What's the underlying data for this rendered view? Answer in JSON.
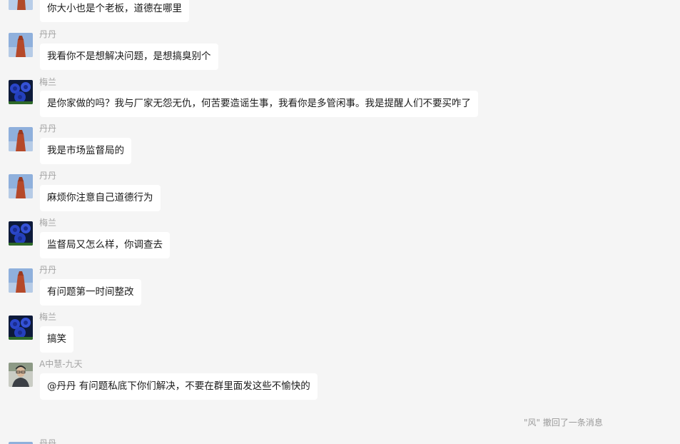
{
  "messages": [
    {
      "sender": "",
      "text": "你大小也是个老板，道德在哪里",
      "avatar": "pagoda-avatar"
    },
    {
      "sender": "丹丹",
      "text": "我看你不是想解决问题，是想搞臭别个",
      "avatar": "pagoda-avatar"
    },
    {
      "sender": "梅兰",
      "text": "是你家做的吗？我与厂家无怨无仇，何苦要造谣生事，我看你是多管闲事。我是提醒人们不要买咋了",
      "avatar": "blue-roses-avatar"
    },
    {
      "sender": "丹丹",
      "text": "我是市场监督局的",
      "avatar": "pagoda-avatar"
    },
    {
      "sender": "丹丹",
      "text": "麻烦你注意自己道德行为",
      "avatar": "pagoda-avatar"
    },
    {
      "sender": "梅兰",
      "text": "监督局又怎么样，你调查去",
      "avatar": "blue-roses-avatar"
    },
    {
      "sender": "丹丹",
      "text": "有问题第一时间整改",
      "avatar": "pagoda-avatar"
    },
    {
      "sender": "梅兰",
      "text": "搞笑",
      "avatar": "blue-roses-avatar"
    },
    {
      "sender": "A中慧-九天",
      "text": "@丹丹 有问题私底下你们解决，不要在群里面发这些不愉快的",
      "avatar": "person-avatar"
    }
  ],
  "system_notice": "\"风\" 撤回了一条消息",
  "partial_message": {
    "sender": "丹丹",
    "avatar": "pagoda-avatar"
  },
  "colors": {
    "background": "#f5f5f5",
    "bubble": "#ffffff",
    "sender": "#a3a3a3",
    "text": "#1a1a1a",
    "notice": "#9a9a9a"
  }
}
